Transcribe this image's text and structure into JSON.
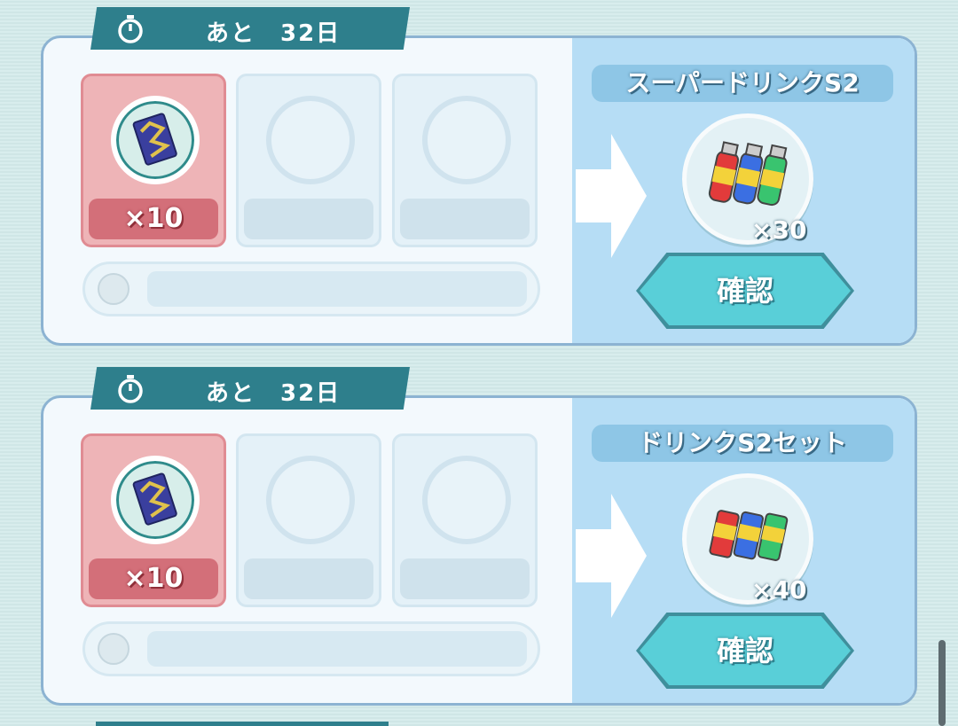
{
  "exchanges": [
    {
      "timer_label": "あと　32日",
      "required_items": [
        {
          "icon": "ticket-card-icon",
          "qty": "×10"
        },
        {
          "icon": "empty-slot"
        },
        {
          "icon": "empty-slot"
        }
      ],
      "reward_name": "スーパードリンクS2",
      "reward_icon": "super-drink-bottles-icon",
      "reward_qty": "×30",
      "confirm_label": "確認"
    },
    {
      "timer_label": "あと　32日",
      "required_items": [
        {
          "icon": "ticket-card-icon",
          "qty": "×10"
        },
        {
          "icon": "empty-slot"
        },
        {
          "icon": "empty-slot"
        }
      ],
      "reward_name": "ドリンクS2セット",
      "reward_icon": "drink-cans-icon",
      "reward_qty": "×40",
      "confirm_label": "確認"
    }
  ],
  "colors": {
    "tab": "#2e7f8c",
    "filled_slot": "#eeb4b7",
    "reward_panel": "#b6ddf5",
    "confirm_button": "#59cfd8"
  }
}
